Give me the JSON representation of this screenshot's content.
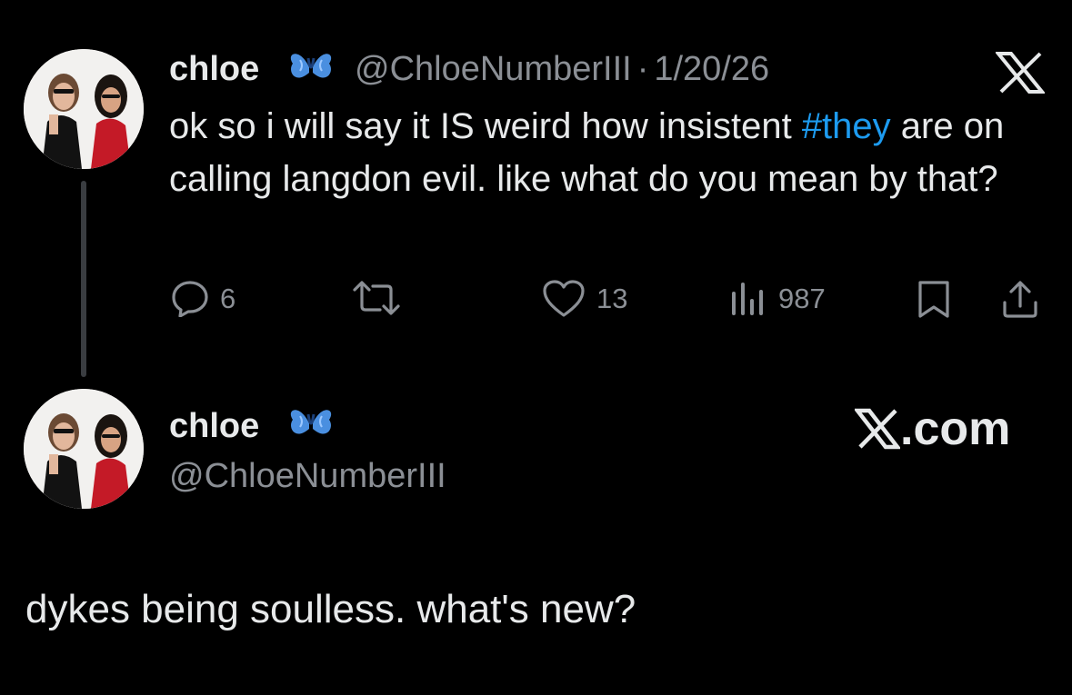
{
  "tweet": {
    "author_name": "chloe",
    "verified_emoji_icon": "butterfly-icon",
    "handle": "@ChloeNumberIII",
    "separator": "·",
    "date": "1/20/26",
    "text_before_hashtag": "ok so i will say it IS weird how insistent ",
    "hashtag": "#they",
    "text_after_hashtag": " are on calling langdon evil. like what do you mean by that?",
    "actions": {
      "reply_count": "6",
      "retweet_count": "",
      "like_count": "13",
      "view_count": "987"
    }
  },
  "profile_card": {
    "author_name": "chloe",
    "handle": "@ChloeNumberIII",
    "site_label": ".com"
  },
  "reply": {
    "text": "dykes being soulless. what's new?"
  },
  "colors": {
    "background": "#000000",
    "primary_text": "#e7e9ea",
    "secondary_text": "#8b8f95",
    "hashtag": "#1d9bf0",
    "butterfly": "#4a8fe0"
  }
}
